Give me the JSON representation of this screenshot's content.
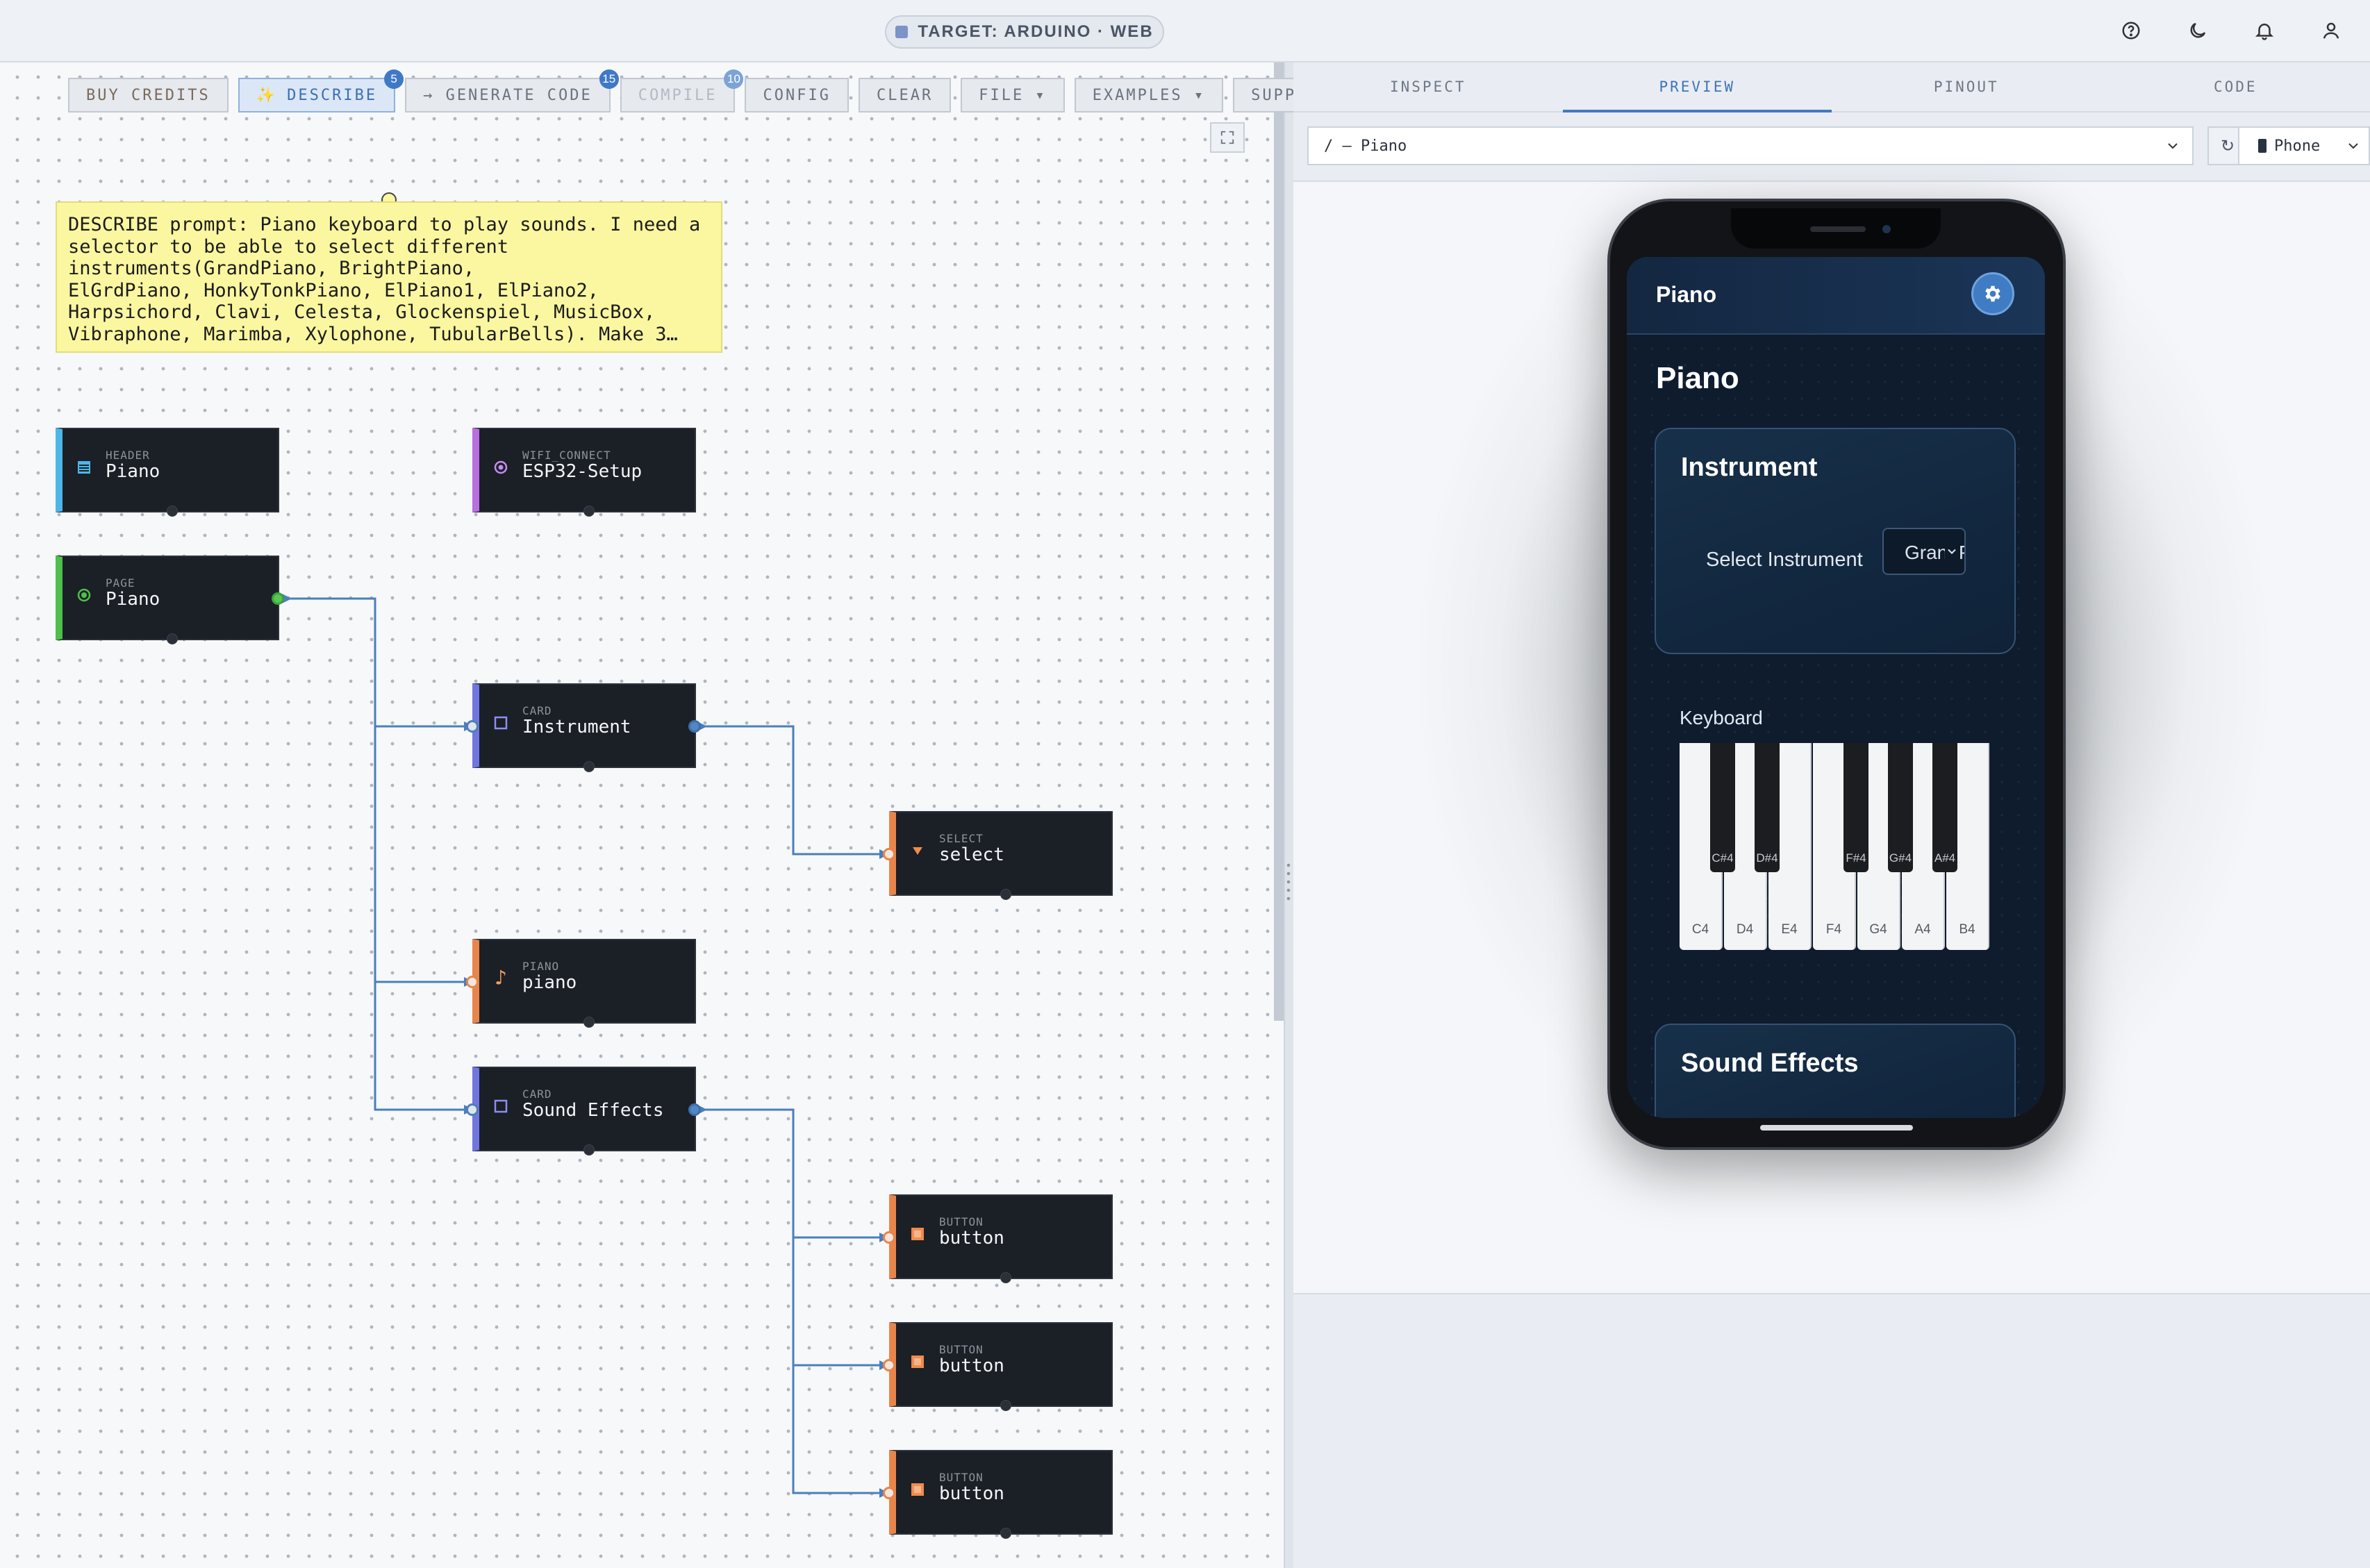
{
  "topbar": {
    "target_label": "TARGET: ARDUINO · WEB",
    "icons": [
      "help-icon",
      "moon-icon",
      "bell-icon",
      "user-icon"
    ]
  },
  "toolbar": {
    "buy_credits": "BUY CREDITS",
    "describe": "DESCRIBE",
    "describe_badge": "5",
    "generate_code": "→ GENERATE CODE",
    "generate_badge": "15",
    "compile": "COMPILE",
    "compile_badge": "10",
    "config": "CONFIG",
    "clear": "CLEAR",
    "file": "FILE ▾",
    "examples": "EXAMPLES ▾",
    "support": "SUPPORT"
  },
  "note": {
    "text": "DESCRIBE prompt: Piano keyboard to play sounds. I need a\nselector to be able to select different\ninstruments(GrandPiano, BrightPiano,\nElGrdPiano, HonkyTonkPiano, ElPiano1, ElPiano2,\nHarpsichord, Clavi, Celesta, Glockenspiel, MusicBox,\nVibraphone, Marimba, Xylophone, TubularBells). Make 3…"
  },
  "nodes": {
    "header": {
      "type": "HEADER",
      "label": "Piano",
      "color": "#4db6e8"
    },
    "wifi": {
      "type": "WIFI_CONNECT",
      "label": "ESP32-Setup",
      "color": "#b86fe0"
    },
    "page": {
      "type": "PAGE",
      "label": "Piano",
      "color": "#4cc04a"
    },
    "card_instrument": {
      "type": "CARD",
      "label": "Instrument",
      "color": "#6f76e0"
    },
    "select": {
      "type": "SELECT",
      "label": "select",
      "color": "#e8854b"
    },
    "piano": {
      "type": "PIANO",
      "label": "piano",
      "color": "#e8854b"
    },
    "card_sound": {
      "type": "CARD",
      "label": "Sound Effects",
      "color": "#6f76e0"
    },
    "button1": {
      "type": "BUTTON",
      "label": "button",
      "color": "#e8854b"
    },
    "button2": {
      "type": "BUTTON",
      "label": "button",
      "color": "#e8854b"
    },
    "button3": {
      "type": "BUTTON",
      "label": "button",
      "color": "#e8854b"
    }
  },
  "right_panel": {
    "tabs": [
      "INSPECT",
      "PREVIEW",
      "PINOUT",
      "CODE"
    ],
    "active_tab": "PREVIEW",
    "route": "/ — Piano",
    "refresh": "↻",
    "device": "Phone"
  },
  "preview": {
    "app_title": "Piano",
    "page_title": "Piano",
    "instrument_card": {
      "title": "Instrument",
      "select_label": "Select Instrument",
      "select_value": "GrandPiano"
    },
    "keyboard": {
      "label": "Keyboard",
      "white_keys": [
        "C4",
        "D4",
        "E4",
        "F4",
        "G4",
        "A4",
        "B4"
      ],
      "black_keys": [
        "C#4",
        "D#4",
        "F#4",
        "G#4",
        "A#4"
      ]
    },
    "sound_card": {
      "title": "Sound Effects"
    }
  }
}
